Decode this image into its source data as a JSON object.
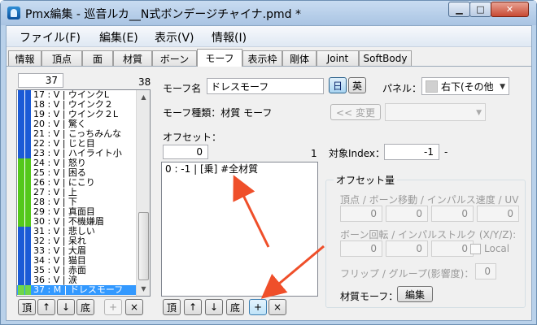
{
  "window": {
    "title": "Pmx編集 - 巡音ルカ__N式ボンデージチャイナ.pmd *",
    "min": "▁",
    "max": "□",
    "close": "✕"
  },
  "menu": [
    "ファイル(F)",
    "編集(E)",
    "表示(V)",
    "情報(I)"
  ],
  "tabs": [
    "情報",
    "頂点",
    "面",
    "材質",
    "ボーン",
    "モーフ",
    "表示枠",
    "剛体",
    "Joint",
    "SoftBody"
  ],
  "active_tab": "モーフ",
  "morph_list": {
    "index_value": "37",
    "count": "38",
    "items": [
      {
        "text": "17 : V | ウインクL",
        "color": "blue"
      },
      {
        "text": "18 : V | ウインク２",
        "color": "blue"
      },
      {
        "text": "19 : V | ウインク２L",
        "color": "blue"
      },
      {
        "text": "20 : V | 驚く",
        "color": "blue"
      },
      {
        "text": "21 : V | こっちみんな",
        "color": "blue"
      },
      {
        "text": "22 : V | じと目",
        "color": "blue"
      },
      {
        "text": "23 : V | ハイライト小",
        "color": "blue"
      },
      {
        "text": "24 : V | 怒り",
        "color": "green"
      },
      {
        "text": "25 : V | 困る",
        "color": "green"
      },
      {
        "text": "26 : V | にこり",
        "color": "green"
      },
      {
        "text": "27 : V | 上",
        "color": "green"
      },
      {
        "text": "28 : V | 下",
        "color": "green"
      },
      {
        "text": "29 : V | 真面目",
        "color": "green"
      },
      {
        "text": "30 : V | 不機嫌眉",
        "color": "green"
      },
      {
        "text": "31 : V | 悲しい",
        "color": "blue"
      },
      {
        "text": "32 : V | 呆れ",
        "color": "blue"
      },
      {
        "text": "33 : V | 大眉",
        "color": "blue"
      },
      {
        "text": "34 : V | 猫目",
        "color": "blue"
      },
      {
        "text": "35 : V | 赤面",
        "color": "blue"
      },
      {
        "text": "36 : V | 涙",
        "color": "blue"
      },
      {
        "text": "37 : M | ドレスモーフ",
        "color": "selected"
      }
    ],
    "buttons": [
      "頂",
      "↑",
      "↓",
      "底",
      "+",
      "×"
    ]
  },
  "morph": {
    "name_label": "モーフ名",
    "name_value": "ドレスモーフ",
    "lang_jp": "日",
    "lang_en": "英",
    "panel_label": "パネル：",
    "panel_value": "右下(その他",
    "type_label": "モーフ種類：材質 モーフ",
    "change_button": "<< 変更",
    "offset_label": "オフセット：",
    "offset_index": "0",
    "offset_count": "1",
    "target_label": "対象Index：",
    "target_value": "-1",
    "target_suffix": "-",
    "offset_items": [
      "0 : -1 | [乗] #全材質"
    ],
    "offset_buttons": [
      "頂",
      "↑",
      "↓",
      "底",
      "+",
      "×"
    ]
  },
  "offset_amount": {
    "title": "オフセット量",
    "row1_label": "頂点 / ボーン移動 / インパルス速度 / UV",
    "row1_values": [
      "0",
      "0",
      "0",
      "0"
    ],
    "row2_label": "ボーン回転 / インパルストルク (X/Y/Z):",
    "row2_values": [
      "0",
      "0",
      "0"
    ],
    "local_label": "Local",
    "flip_label": "フリップ / グループ(影響度)：",
    "flip_value": "0",
    "material_label": "材質モーフ：",
    "edit_button": "編集"
  },
  "colors": {
    "annotation_arrow": "#ef4f2a",
    "selection": "#3399ff"
  }
}
